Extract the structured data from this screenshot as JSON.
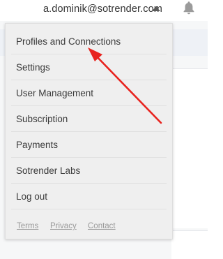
{
  "header": {
    "user_email": "a.dominik@sotrender.com",
    "caret_icon": "caret-up-icon",
    "notifications_icon": "bell-icon"
  },
  "menu": {
    "items": [
      {
        "label": "Profiles and Connections"
      },
      {
        "label": "Settings"
      },
      {
        "label": "User Management"
      },
      {
        "label": "Subscription"
      },
      {
        "label": "Payments"
      },
      {
        "label": "Sotrender Labs"
      },
      {
        "label": "Log out"
      }
    ],
    "footer_links": [
      {
        "label": "Terms"
      },
      {
        "label": "Privacy"
      },
      {
        "label": "Contact"
      }
    ]
  },
  "annotation": {
    "arrow_color": "#e8231e",
    "icon": "red-arrow-icon"
  },
  "colors": {
    "menu_background": "#efefef",
    "text": "#3a3a3a",
    "footer_link": "#9a9a9a",
    "caret": "#5a5a5a",
    "bell": "#9b9b9b"
  }
}
